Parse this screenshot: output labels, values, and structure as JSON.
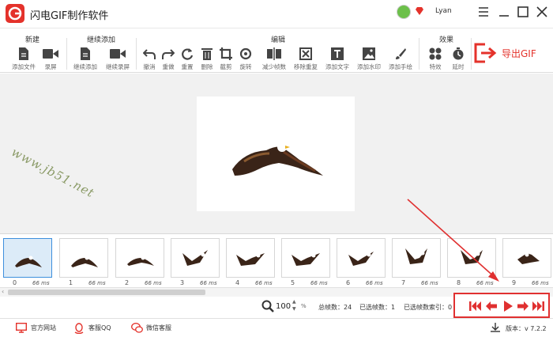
{
  "app": {
    "title": "闪电GIF制作软件",
    "user_name": "Lyan"
  },
  "toolbar": {
    "groups": {
      "new": "新建",
      "continue_add": "继续添加",
      "edit": "编辑",
      "effects": "效果"
    },
    "tools": {
      "add_file": "添加文件",
      "record": "录屏",
      "continue_add": "继续添加",
      "continue_record": "继续录屏",
      "undo": "撤消",
      "redo": "重做",
      "reset": "重置",
      "delete": "删除",
      "crop": "截剪",
      "rotate": "旋转",
      "reduce_frames": "减少帧数",
      "remove_duplicates": "移除重复",
      "add_text": "添加文字",
      "add_watermark": "添加水印",
      "add_handwriting": "添加手绘",
      "effects": "特效",
      "delay": "延时"
    },
    "export_label": "导出GIF"
  },
  "canvas": {
    "watermark": "www.jb51.net"
  },
  "frames": [
    {
      "index": "0",
      "ms": "66 ms",
      "selected": true
    },
    {
      "index": "1",
      "ms": "66 ms"
    },
    {
      "index": "2",
      "ms": "66 ms"
    },
    {
      "index": "3",
      "ms": "66 ms"
    },
    {
      "index": "4",
      "ms": "66 ms"
    },
    {
      "index": "5",
      "ms": "66 ms"
    },
    {
      "index": "6",
      "ms": "66 ms"
    },
    {
      "index": "7",
      "ms": "66 ms"
    },
    {
      "index": "8",
      "ms": "66 ms"
    },
    {
      "index": "9",
      "ms": "66 ms"
    }
  ],
  "status": {
    "zoom_value": "100",
    "zoom_unit": "%",
    "total_frames": "总帧数：24",
    "selected_frames": "已选帧数：1",
    "selected_index": "已选帧数索引：0"
  },
  "footer": {
    "official_site": "官方网站",
    "qq_support": "客服QQ",
    "wechat_support": "微信客服",
    "version": "版本：v 7.2.2"
  },
  "colors": {
    "brand_red": "#e4322b",
    "selected_blue": "#3d8fdd",
    "annotation_red": "#e03030"
  }
}
